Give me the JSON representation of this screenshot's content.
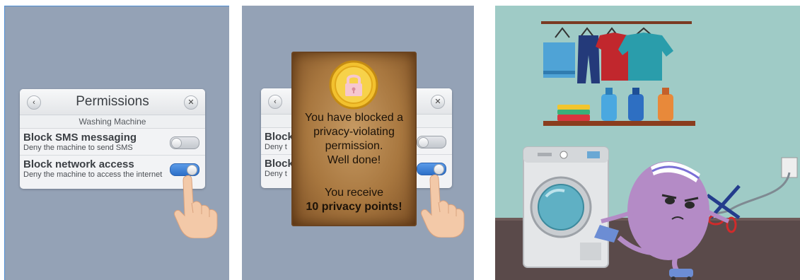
{
  "panel1": {
    "dialog": {
      "title": "Permissions",
      "back_icon": "chevron-left-icon",
      "close_icon": "close-icon",
      "device": "Washing Machine",
      "items": [
        {
          "title": "Block SMS messaging",
          "description": "Deny the machine to send SMS",
          "enabled": false
        },
        {
          "title": "Block network access",
          "description": "Deny the machine to access the internet",
          "enabled": true
        }
      ]
    }
  },
  "panel2": {
    "dialog": {
      "items": [
        {
          "title_partial": "Block",
          "description_partial": "Deny t",
          "enabled": false
        },
        {
          "title_partial": "Block",
          "description_partial": "Deny t",
          "enabled": true
        }
      ]
    },
    "reward": {
      "icon": "padlock-coin-icon",
      "message_line1": "You have blocked a",
      "message_line2": "privacy-violating",
      "message_line3": "permission.",
      "message_line4": "Well done!",
      "receive_text": "You receive",
      "points_text": "10 privacy points!"
    }
  },
  "panel3": {
    "scene": "laundry-room-illustration",
    "colors": {
      "wall": "#9fcbc6",
      "floor": "#5a4a4a",
      "character": "#b48bc6",
      "shelf": "#8a3d1e"
    }
  },
  "colors": {
    "panel_bg": "#94a2b6",
    "toggle_on": "#3a7fd5",
    "parchment": "#a8773f",
    "coin": "#f2c12e"
  }
}
